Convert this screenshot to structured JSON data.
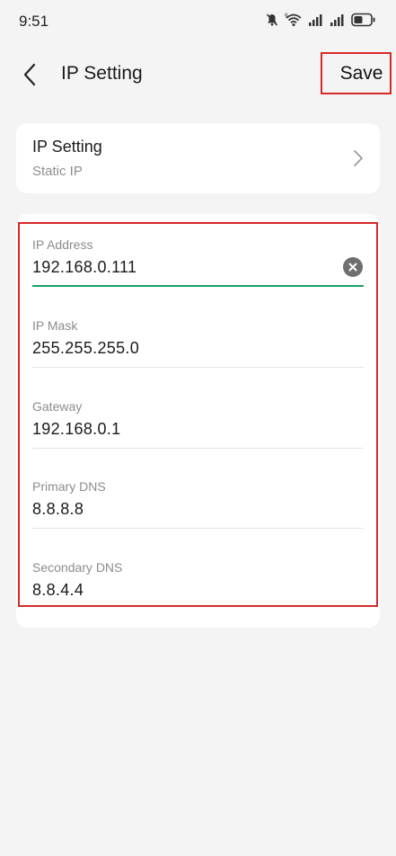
{
  "status_bar": {
    "time": "9:51",
    "icons": [
      "bell-muted-icon",
      "wifi-6-icon",
      "signal-icon",
      "signal-icon",
      "battery-icon"
    ]
  },
  "header": {
    "title": "IP Setting",
    "save_label": "Save"
  },
  "mode_card": {
    "title": "IP Setting",
    "subtitle": "Static IP"
  },
  "fields": [
    {
      "label": "IP Address",
      "value": "192.168.0.111",
      "active": true
    },
    {
      "label": "IP Mask",
      "value": "255.255.255.0",
      "active": false
    },
    {
      "label": "Gateway",
      "value": "192.168.0.1",
      "active": false
    },
    {
      "label": "Primary DNS",
      "value": "8.8.8.8",
      "active": false
    },
    {
      "label": "Secondary DNS",
      "value": "8.8.4.4",
      "active": false
    }
  ],
  "colors": {
    "accent_active_underline": "#1aa067",
    "highlight_border": "#d62a2a",
    "background": "#f4f4f4"
  }
}
